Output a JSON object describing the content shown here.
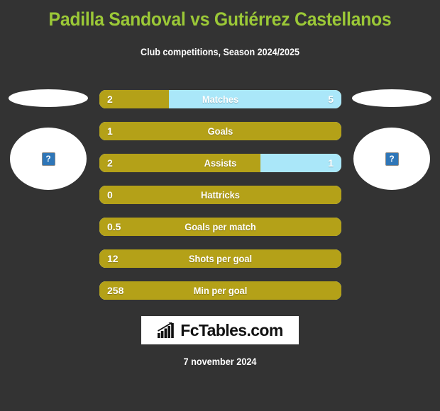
{
  "header": {
    "title": "Padilla Sandoval vs Gutiérrez Castellanos",
    "subtitle": "Club competitions, Season 2024/2025"
  },
  "colors": {
    "background": "#333333",
    "title_green": "#9BC837",
    "home_gold": "#B4A118",
    "away_blue": "#AAE7F9",
    "text_white": "#FFFFFF",
    "broken_icon_blue": "#2E76B8"
  },
  "players": {
    "home": {
      "name": "",
      "avatar_icon": "broken-image-icon",
      "avatar_glyph": "?"
    },
    "away": {
      "name": "",
      "avatar_icon": "broken-image-icon",
      "avatar_glyph": "?"
    }
  },
  "chart_data": {
    "type": "bar",
    "title": "Padilla Sandoval vs Gutiérrez Castellanos",
    "subtitle": "Club competitions, Season 2024/2025",
    "orientation": "horizontal-split",
    "series": [
      {
        "name": "Padilla Sandoval",
        "color": "#B4A118",
        "side": "left"
      },
      {
        "name": "Gutiérrez Castellanos",
        "color": "#AAE7F9",
        "side": "right"
      }
    ],
    "categories": [
      "Matches",
      "Goals",
      "Assists",
      "Hattricks",
      "Goals per match",
      "Shots per goal",
      "Min per goal"
    ],
    "rows": [
      {
        "label": "Matches",
        "home": "2",
        "away": "5",
        "home_pct": 28.6
      },
      {
        "label": "Goals",
        "home": "1",
        "away": "",
        "home_pct": 100
      },
      {
        "label": "Assists",
        "home": "2",
        "away": "1",
        "home_pct": 66.7
      },
      {
        "label": "Hattricks",
        "home": "0",
        "away": "",
        "home_pct": 100
      },
      {
        "label": "Goals per match",
        "home": "0.5",
        "away": "",
        "home_pct": 100
      },
      {
        "label": "Shots per goal",
        "home": "12",
        "away": "",
        "home_pct": 100
      },
      {
        "label": "Min per goal",
        "home": "258",
        "away": "",
        "home_pct": 100
      }
    ]
  },
  "footer": {
    "logo_text": "FcTables.com",
    "logo_icon": "bar-chart-growth-icon",
    "date": "7 november 2024"
  }
}
